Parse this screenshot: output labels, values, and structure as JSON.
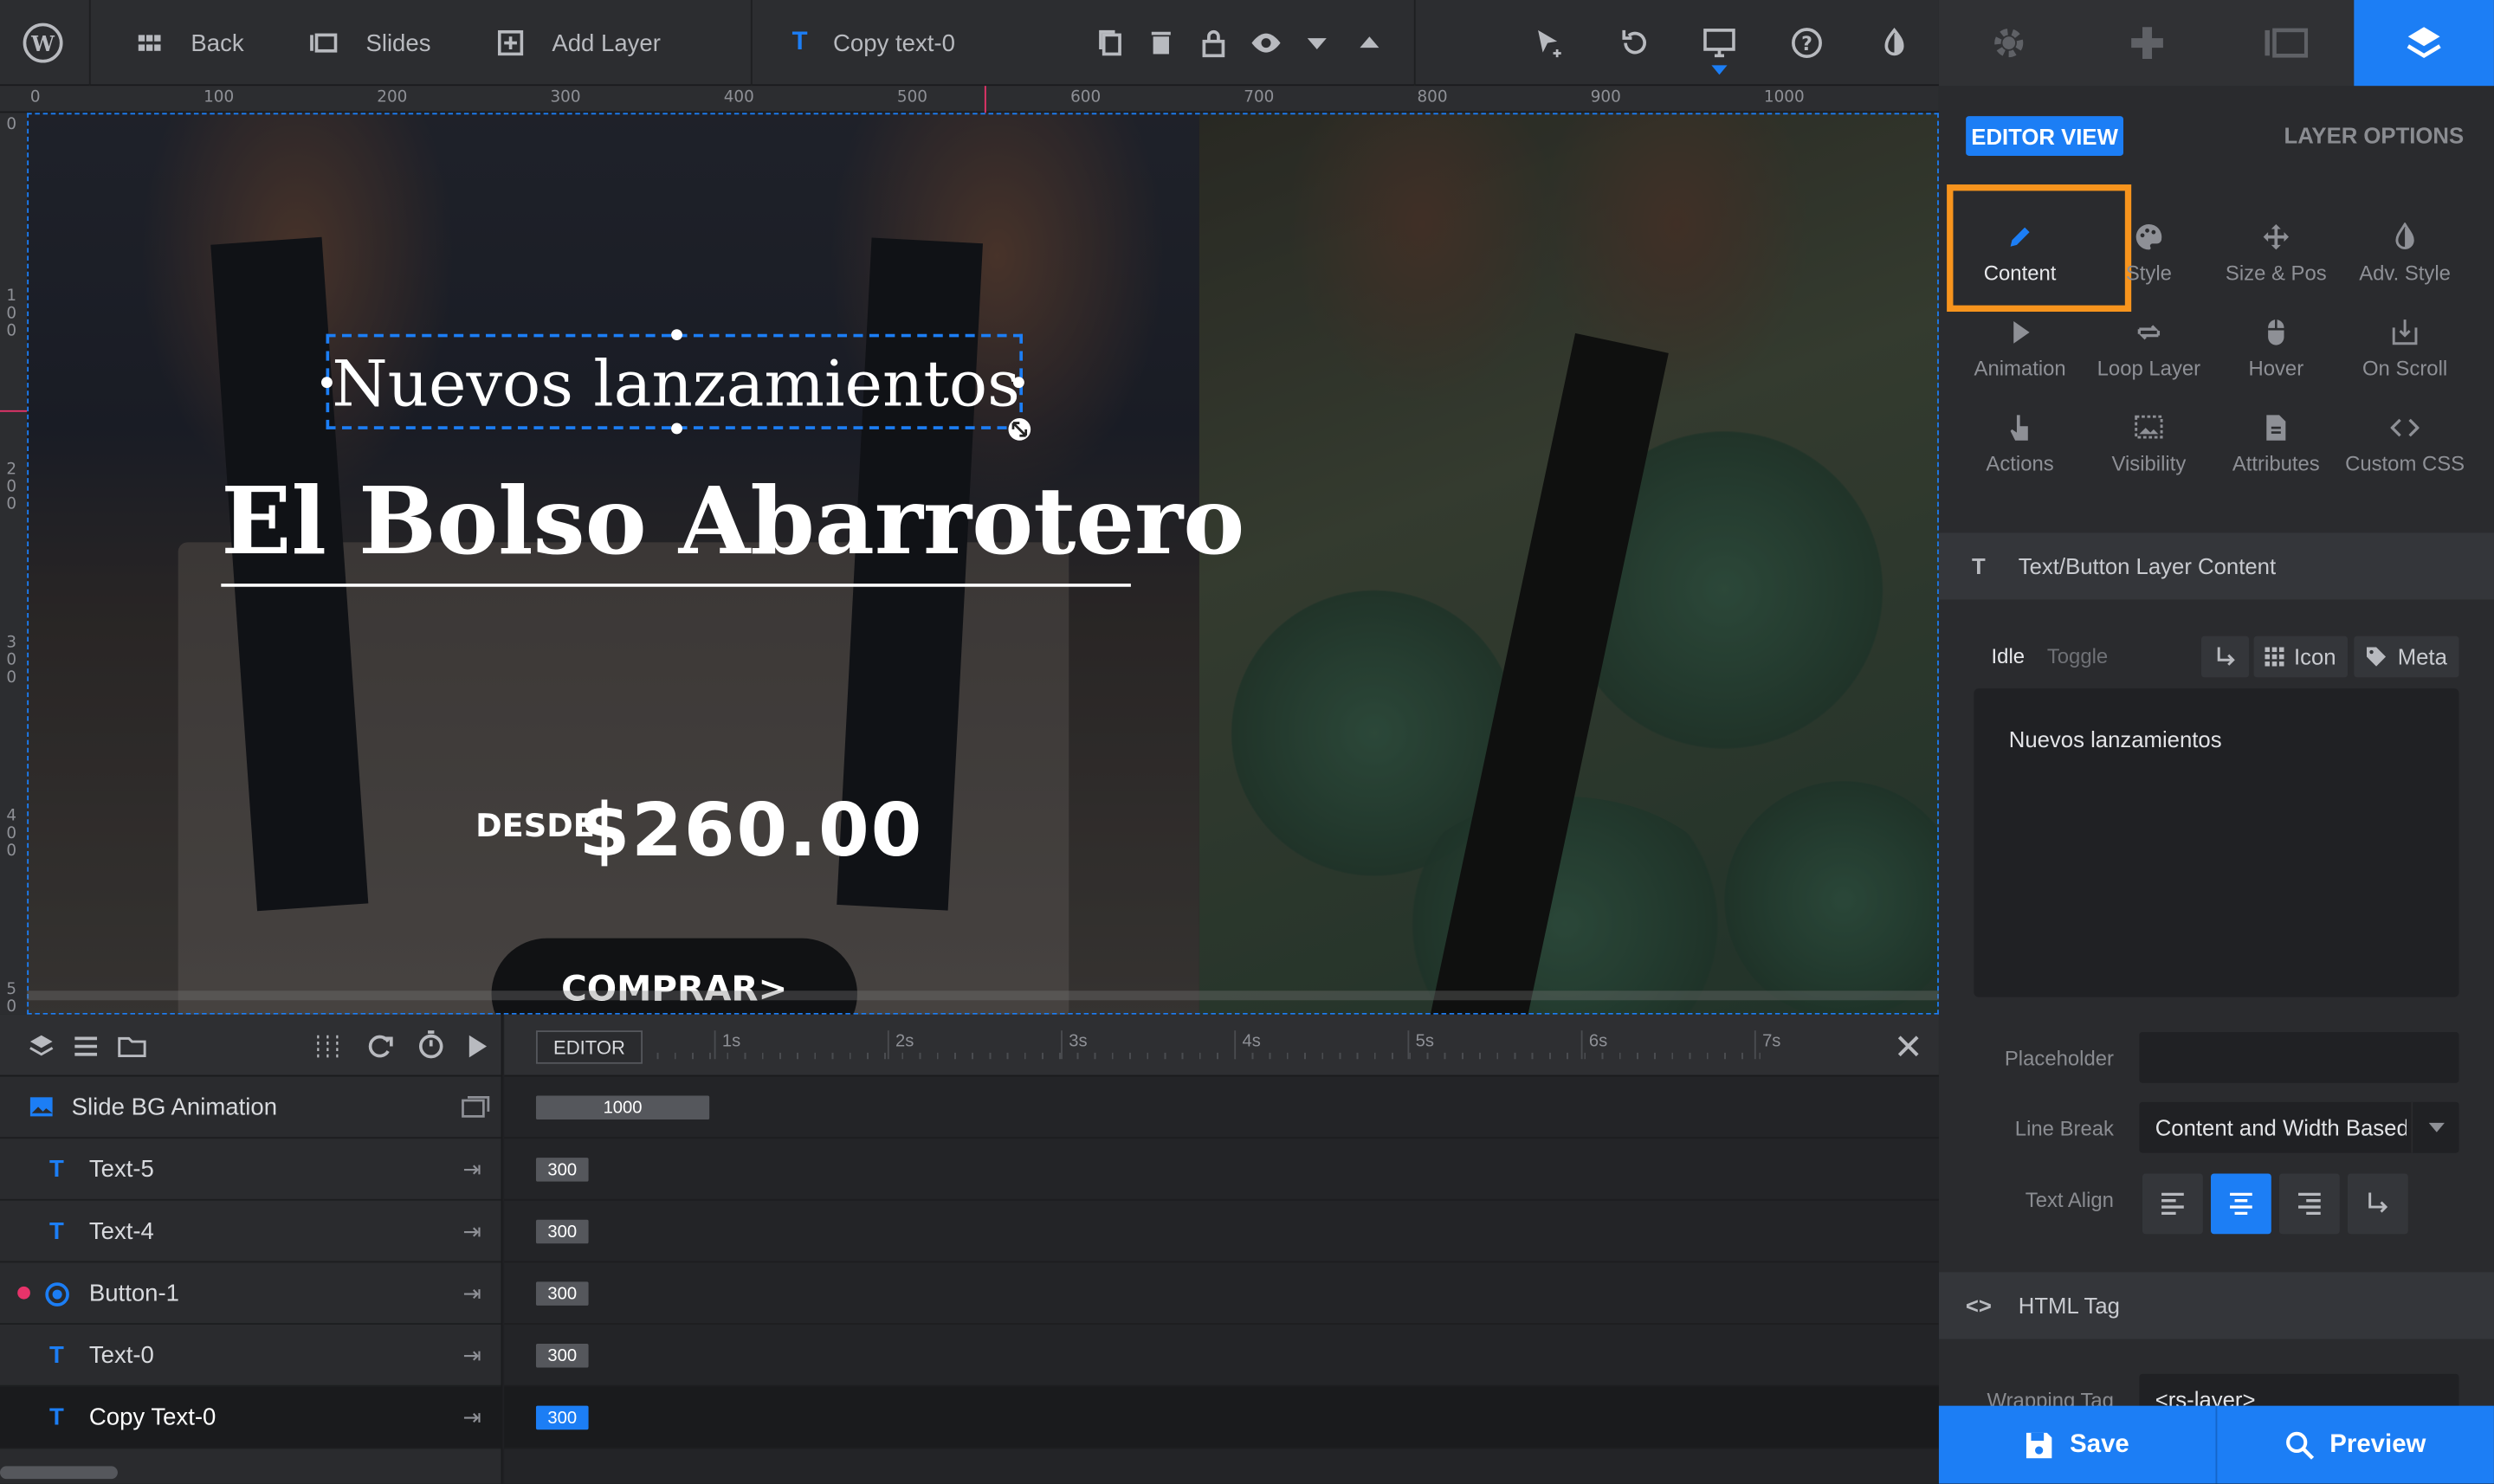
{
  "topbar": {
    "back_label": "Back",
    "slides_label": "Slides",
    "add_layer_label": "Add Layer",
    "current_layer_label": "Copy text-0"
  },
  "rulers": {
    "top": [
      "0",
      "100",
      "200",
      "300",
      "400",
      "500",
      "600",
      "700",
      "800",
      "900",
      "1000"
    ],
    "left": [
      "0",
      "1\n0\n0",
      "2\n0\n0",
      "3\n0\n0",
      "4\n0\n0",
      "5\n0"
    ]
  },
  "canvas": {
    "headline_small": "Nuevos lanzamientos",
    "headline_large": "El Bolso Abarrotero",
    "price_prefix": "DESDE",
    "price": "$260.00",
    "button_label": "COMPRAR>"
  },
  "timeline": {
    "editor_tag": "EDITOR",
    "seconds": [
      "1s",
      "2s",
      "3s",
      "4s",
      "5s",
      "6s",
      "7s"
    ],
    "rows": [
      {
        "label": "Slide BG Animation",
        "duration": "1000"
      },
      {
        "label": "Text-5",
        "duration": "300"
      },
      {
        "label": "Text-4",
        "duration": "300"
      },
      {
        "label": "Button-1",
        "duration": "300"
      },
      {
        "label": "Text-0",
        "duration": "300"
      },
      {
        "label": "Copy Text-0",
        "duration": "300"
      }
    ]
  },
  "panel": {
    "editor_view": "EDITOR VIEW",
    "layer_options": "LAYER OPTIONS",
    "options": [
      "Content",
      "Style",
      "Size & Pos",
      "Adv. Style",
      "Animation",
      "Loop Layer",
      "Hover",
      "On Scroll",
      "Actions",
      "Visibility",
      "Attributes",
      "Custom CSS"
    ],
    "section_content": "Text/Button Layer Content",
    "tab_idle": "Idle",
    "tab_toggle": "Toggle",
    "icon_label": "Icon",
    "meta_label": "Meta",
    "content_text": "Nuevos lanzamientos",
    "placeholder_label": "Placeholder",
    "placeholder_value": "",
    "line_break_label": "Line Break",
    "line_break_value": "Content and Width Based",
    "text_align_label": "Text Align",
    "section_html": "HTML Tag",
    "wrapping_tag_label": "Wrapping Tag",
    "wrapping_tag_value": "<rs-layer>",
    "save_label": "Save",
    "preview_label": "Preview"
  },
  "colors": {
    "accent": "#1c7ef5",
    "highlight": "#f7941d",
    "button_marker": "#e8336a"
  }
}
